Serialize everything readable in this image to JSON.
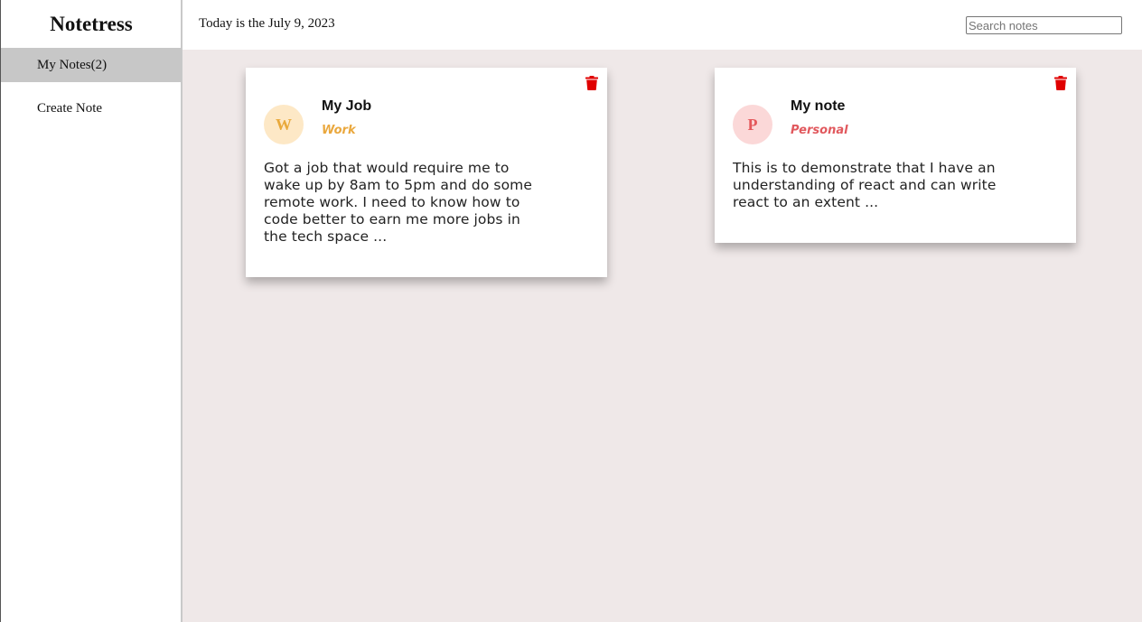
{
  "sidebar": {
    "brand": "Notetress",
    "items": [
      {
        "label": "My Notes(2)",
        "active": true
      },
      {
        "label": "Create Note",
        "active": false
      }
    ]
  },
  "header": {
    "today": "Today is the July 9, 2023",
    "search_placeholder": "Search notes",
    "search_value": ""
  },
  "notes": [
    {
      "initial": "W",
      "title": "My Job",
      "category": "Work",
      "body": "Got a job that would require me to wake up by 8am to 5pm and do some remote work. I need to know how to code better to earn me more jobs in the tech space ...",
      "icon": "trash-icon"
    },
    {
      "initial": "P",
      "title": "My note",
      "category": "Personal",
      "body": "This is to demonstrate that I have an understanding of react and can write react to an extent ...",
      "icon": "trash-icon"
    }
  ],
  "colors": {
    "main_bg": "#efe8e8",
    "active_nav": "#c7c7c7",
    "work_accent": "#eaa83e",
    "work_avatar_bg": "#fde8c6",
    "personal_accent": "#e1595e",
    "personal_avatar_bg": "#fbd8d8",
    "delete_icon": "#e00000"
  }
}
